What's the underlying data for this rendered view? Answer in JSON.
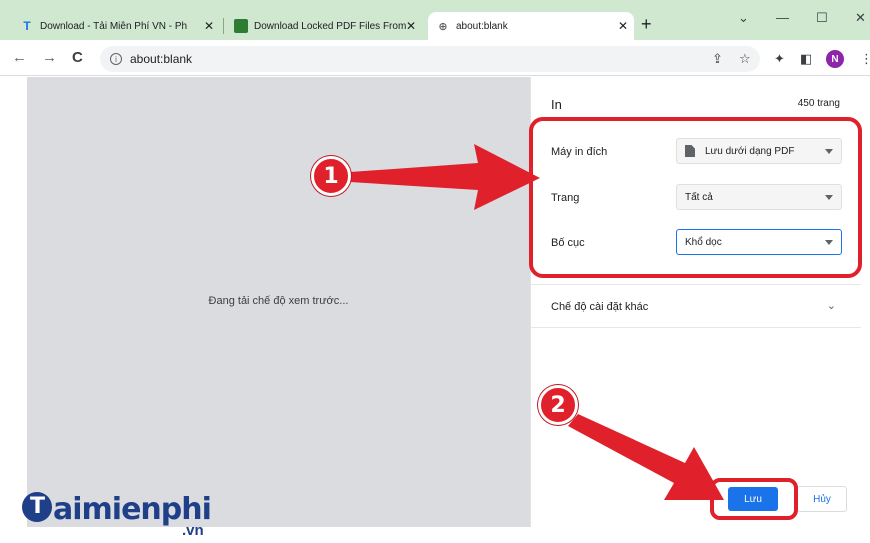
{
  "tabs": [
    {
      "title": "Download - Tải Miễn Phí VN - Ph",
      "favicon": "T"
    },
    {
      "title": "Download Locked PDF Files From",
      "favicon": "pdf-icon"
    },
    {
      "title": "about:blank",
      "favicon": "globe-icon"
    }
  ],
  "address_bar": {
    "url": "about:blank"
  },
  "profile": {
    "initial": "N"
  },
  "preview": {
    "loading_text": "Đang tải chế độ xem trước..."
  },
  "print_panel": {
    "title": "In",
    "page_count": "450 trang",
    "destination": {
      "label": "Máy in đích",
      "value": "Lưu dưới dạng PDF"
    },
    "pages": {
      "label": "Trang",
      "value": "Tất cả"
    },
    "layout": {
      "label": "Bố cục",
      "value": "Khổ dọc"
    },
    "more_settings": "Chế độ cài đặt khác",
    "save_label": "Lưu",
    "cancel_label": "Hủy"
  },
  "annotations": {
    "step1": "1",
    "step2": "2"
  },
  "watermark": {
    "main": "aimienphi",
    "suffix": ".vn"
  },
  "colors": {
    "accent": "#1a73e8",
    "highlight": "#e0202a",
    "tabstrip": "#cfe8cf"
  }
}
